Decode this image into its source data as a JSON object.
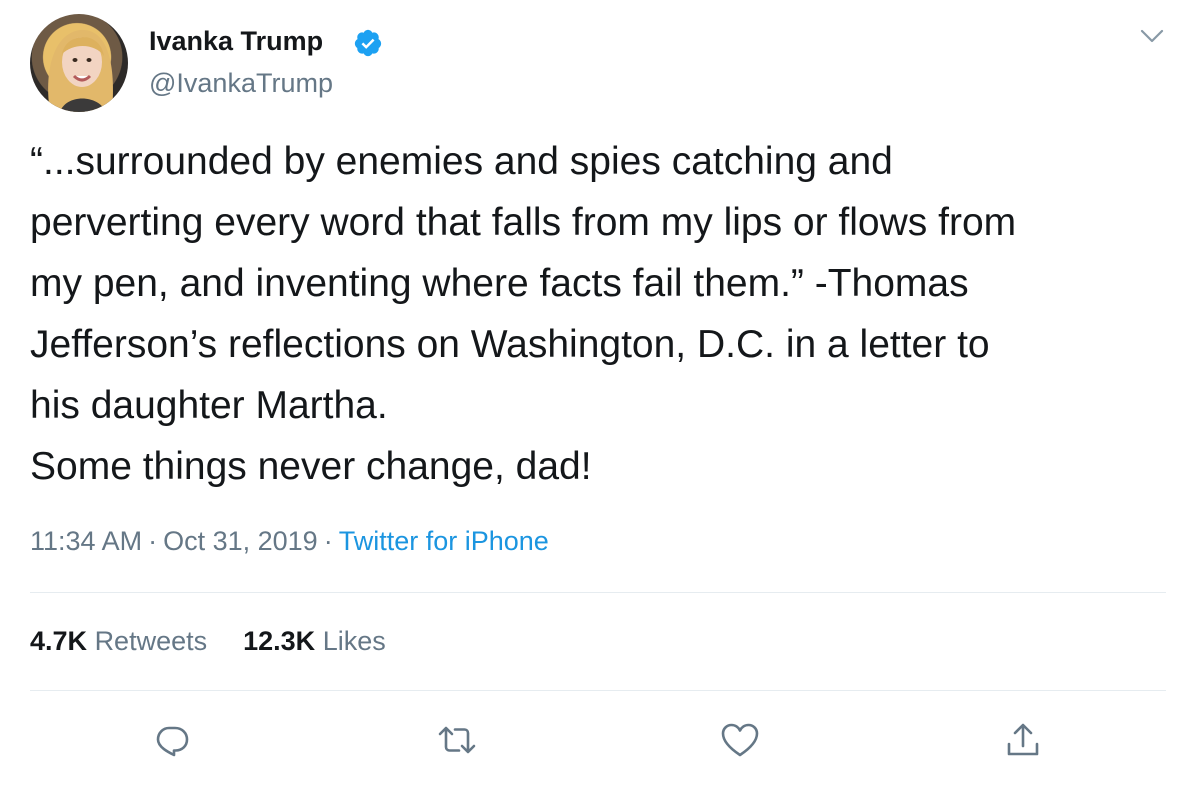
{
  "user": {
    "display_name": "Ivanka Trump",
    "handle": "@IvankaTrump",
    "verified_icon": "verified-badge-icon",
    "verified_color": "#1da1f2"
  },
  "tweet": {
    "lines": [
      "“...surrounded by enemies and spies catching and",
      "perverting every word that falls from my lips or flows from",
      "my pen, and inventing where facts fail them.” -Thomas",
      "Jefferson’s reflections on Washington, D.C. in a letter to",
      "his daughter Martha.",
      "Some things never change, dad!"
    ]
  },
  "meta": {
    "time": "11:34 AM",
    "separator": "·",
    "date": "Oct 31, 2019",
    "source": "Twitter for iPhone",
    "source_color": "#1b95e0"
  },
  "stats": {
    "retweets_count": "4.7K",
    "retweets_label": "Retweets",
    "likes_count": "12.3K",
    "likes_label": "Likes"
  },
  "actions": {
    "reply_icon": "reply-icon",
    "retweet_icon": "retweet-icon",
    "like_icon": "heart-icon",
    "share_icon": "share-icon",
    "icon_color": "#657786"
  }
}
